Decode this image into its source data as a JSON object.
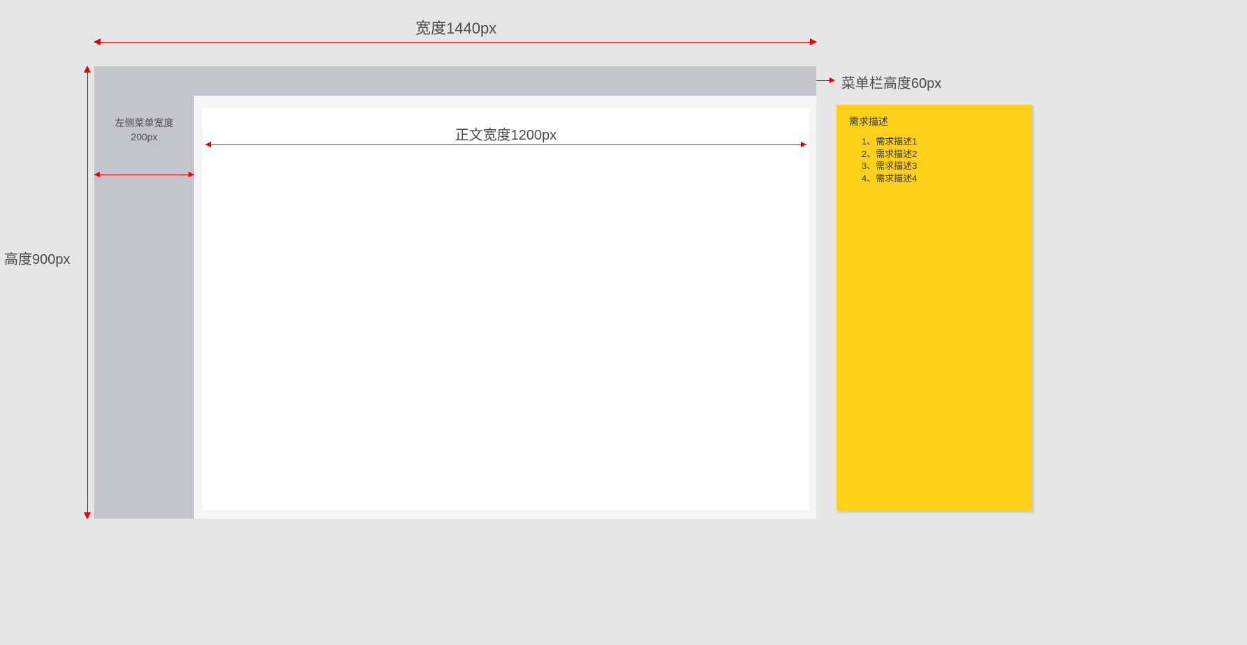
{
  "dimensions": {
    "total_width_label": "宽度1440px",
    "total_height_label": "高度900px",
    "menubar_height_label": "菜单栏高度60px",
    "sidebar_width_label_line1": "左侧菜单宽度",
    "sidebar_width_label_line2": "200px",
    "content_width_label": "正文宽度1200px"
  },
  "note": {
    "title": "需求描述",
    "items": [
      "1、需求描述1",
      "2、需求描述2",
      "3、需求描述3",
      "4、需求描述4"
    ]
  },
  "colors": {
    "dimension_line": "#e60000",
    "panel_gray": "#c2c5ce",
    "background": "#e6e6e6",
    "note_bg": "#ffd11a"
  }
}
